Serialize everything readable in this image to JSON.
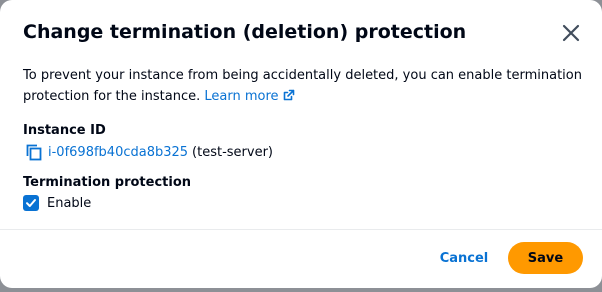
{
  "dialog": {
    "title": "Change termination (deletion) protection",
    "description": "To prevent your instance from being accidentally deleted, you can enable termination protection for the instance.",
    "learn_more_label": "Learn more",
    "instance_id_label": "Instance ID",
    "instance_id": "i-0f698fb40cda8b325",
    "instance_name": "(test-server)",
    "termination_protection_label": "Termination protection",
    "enable_label": "Enable",
    "enable_checked": true
  },
  "footer": {
    "cancel_label": "Cancel",
    "save_label": "Save"
  },
  "icons": {
    "close": "close-icon",
    "external_link": "external-link-icon",
    "copy": "copy-icon",
    "check": "check-icon"
  },
  "colors": {
    "link": "#0972d3",
    "primary_button": "#ff9900",
    "text": "#000716",
    "backdrop": "#8d9096"
  }
}
